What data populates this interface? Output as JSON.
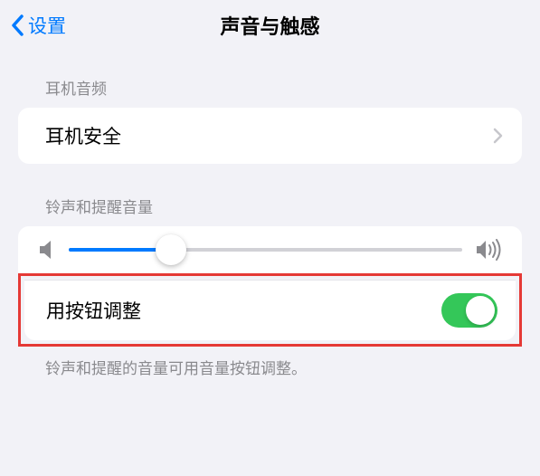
{
  "nav": {
    "back_label": "设置",
    "title": "声音与触感"
  },
  "section1": {
    "header": "耳机音频",
    "item_label": "耳机安全"
  },
  "section2": {
    "header": "铃声和提醒音量",
    "toggle_label": "用按钮调整",
    "footer": "铃声和提醒的音量可用音量按钮调整。",
    "slider_value": 26
  }
}
